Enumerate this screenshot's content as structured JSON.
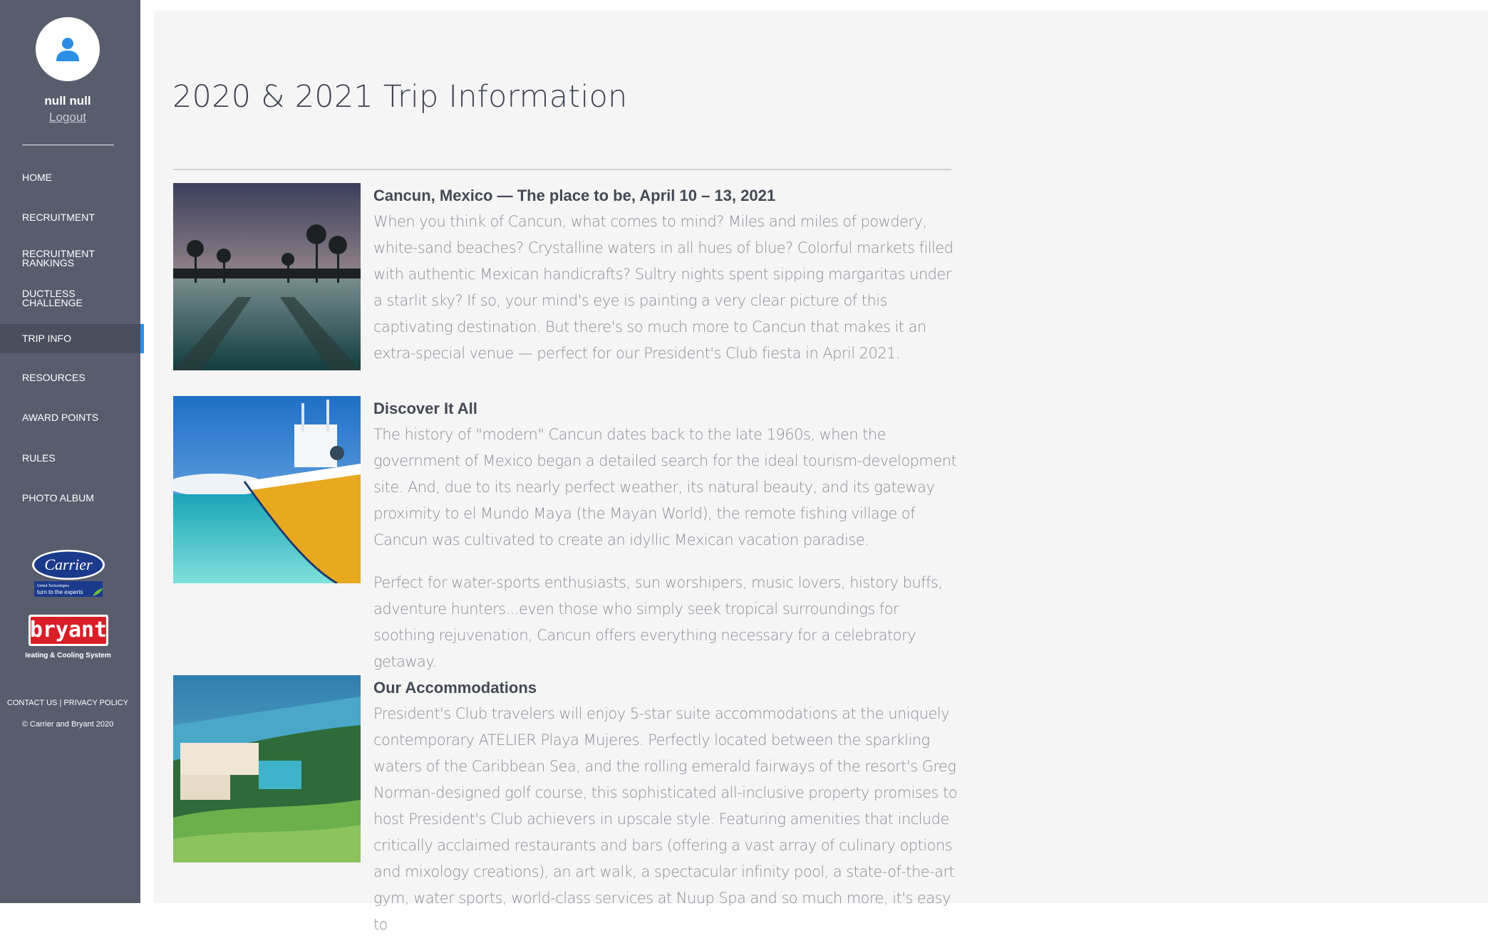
{
  "user": {
    "name": "null null",
    "logout_label": "Logout"
  },
  "nav": {
    "items": [
      {
        "label": "HOME"
      },
      {
        "label": "RECRUITMENT"
      },
      {
        "label": "RECRUITMENT\nRANKINGS"
      },
      {
        "label": "DUCTLESS\nCHALLENGE"
      },
      {
        "label": "TRIP INFO"
      },
      {
        "label": "RESOURCES"
      },
      {
        "label": "AWARD POINTS"
      },
      {
        "label": "RULES"
      },
      {
        "label": "PHOTO ALBUM"
      }
    ],
    "active": "TRIP INFO"
  },
  "logos": {
    "carrier": {
      "name": "Carrier",
      "tagline": "turn to the experts",
      "sub": "United Technologies"
    },
    "bryant": {
      "name": "bryant",
      "tagline": "Heating & Cooling Systems"
    }
  },
  "footer": {
    "contact": "CONTACT US",
    "separator": " | ",
    "privacy": "PRIVACY POLICY",
    "copyright": "© Carrier and Bryant 2020"
  },
  "page": {
    "title": "2020 & 2021 Trip Information"
  },
  "sections": [
    {
      "image_icon": "resort-pool-sunset-photo",
      "heading": "Cancun, Mexico — The place to be, April 10 – 13, 2021",
      "paragraphs": [
        "When you think of Cancun, what comes to mind? Miles and miles of powdery, white-sand beaches? Crystalline waters in all hues of blue? Colorful markets filled with authentic Mexican handicrafts? Sultry nights spent sipping margaritas under a starlit sky? If so, your mind's eye is painting a very clear picture of this captivating destination. But there's so much more to Cancun that makes it an extra-special venue — perfect for our President's Club fiesta in April 2021."
      ]
    },
    {
      "image_icon": "boat-turquoise-water-photo",
      "heading": "Discover It All",
      "paragraphs": [
        "The history of \"modern\" Cancun dates back to the late 1960s, when the government of Mexico began a detailed search for the ideal tourism-development site. And, due to its nearly perfect weather, its natural beauty, and its gateway proximity to el Mundo Maya (the Mayan World), the remote fishing village of Cancun was cultivated to create an idyllic Mexican vacation paradise.",
        "Perfect for water-sports enthusiasts, sun worshipers, music lovers, history buffs, adventure hunters...even those who simply seek tropical surroundings for soothing rejuvenation, Cancun offers everything necessary for a celebratory getaway."
      ]
    },
    {
      "image_icon": "resort-aerial-photo",
      "heading": "Our Accommodations",
      "paragraphs": [
        "President's Club travelers will enjoy 5-star suite accommodations at the uniquely contemporary ATELIER Playa Mujeres. Perfectly located between the sparkling waters of the Caribbean Sea, and the rolling emerald fairways of the resort's Greg Norman-designed golf course, this sophisticated all-inclusive property promises to host President's Club achievers in upscale style. Featuring amenities that include critically acclaimed restaurants and bars (offering a vast array of culinary options and mixology creations), an art walk, a spectacular infinity pool, a state-of-the-art gym, water sports, world-class services at Nuup Spa and so much more, it's easy to"
      ]
    }
  ]
}
